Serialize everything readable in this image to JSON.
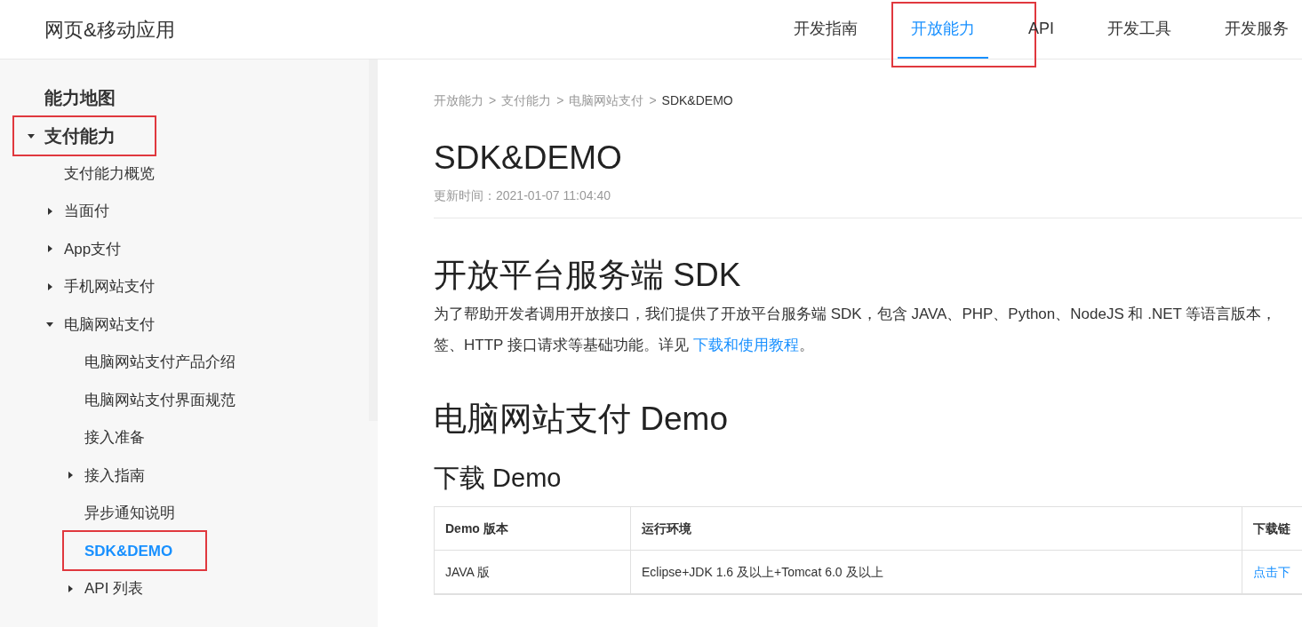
{
  "header": {
    "title": "网页&移动应用",
    "nav": [
      {
        "label": "开发指南",
        "selected": false,
        "annotated": false
      },
      {
        "label": "开放能力",
        "selected": true,
        "annotated": true
      },
      {
        "label": "API",
        "selected": false,
        "annotated": false
      },
      {
        "label": "开发工具",
        "selected": false,
        "annotated": false
      },
      {
        "label": "开发服务",
        "selected": false,
        "annotated": false
      }
    ]
  },
  "sidebar": {
    "items": [
      {
        "label": "能力地图",
        "annotated": false,
        "selected": false
      },
      {
        "label": "支付能力",
        "expanded": true,
        "annotated": true,
        "selected": false,
        "children": [
          {
            "label": "支付能力概览",
            "annotated": false,
            "selected": false
          },
          {
            "label": "当面付",
            "expanded": false,
            "annotated": false,
            "selected": false
          },
          {
            "label": "App支付",
            "expanded": false,
            "annotated": false,
            "selected": false
          },
          {
            "label": "手机网站支付",
            "expanded": false,
            "annotated": false,
            "selected": false
          },
          {
            "label": "电脑网站支付",
            "expanded": true,
            "annotated": false,
            "selected": false,
            "children": [
              {
                "label": "电脑网站支付产品介绍",
                "annotated": false,
                "selected": false
              },
              {
                "label": "电脑网站支付界面规范",
                "annotated": false,
                "selected": false
              },
              {
                "label": "接入准备",
                "annotated": false,
                "selected": false
              },
              {
                "label": "接入指南",
                "expanded": false,
                "annotated": false,
                "selected": false
              },
              {
                "label": "异步通知说明",
                "annotated": false,
                "selected": false
              },
              {
                "label": "SDK&DEMO",
                "annotated": true,
                "selected": true
              },
              {
                "label": "API 列表",
                "expanded": false,
                "annotated": false,
                "selected": false
              }
            ]
          }
        ]
      }
    ]
  },
  "breadcrumb": [
    "开放能力",
    "支付能力",
    "电脑网站支付",
    "SDK&DEMO"
  ],
  "breadcrumb_separator": ">",
  "page_title": "SDK&DEMO",
  "updated": "更新时间：2021-01-07 11:04:40",
  "sections": [
    {
      "kind": "h2",
      "text": "开放平台服务端 SDK"
    },
    {
      "kind": "paragraph",
      "lines": [
        "为了帮助开发者调用开放接口，我们提供了开放平台服务端 SDK，包含 JAVA、PHP、Python、NodeJS 和 .NET 等语言版本，",
        "签、HTTP 接口请求等基础功能。详见 "
      ],
      "link": "下载和使用教程",
      "end": "。"
    },
    {
      "kind": "h2",
      "text": "电脑网站支付 Demo"
    },
    {
      "kind": "h3",
      "text": "下载 Demo"
    }
  ],
  "table": {
    "columns": [
      "Demo 版本",
      "运行环境",
      "下载链"
    ],
    "rows": [
      {
        "cells": [
          "JAVA 版",
          "Eclipse+JDK 1.6 及以上+Tomcat 6.0 及以上"
        ],
        "link": "点击下"
      }
    ]
  }
}
